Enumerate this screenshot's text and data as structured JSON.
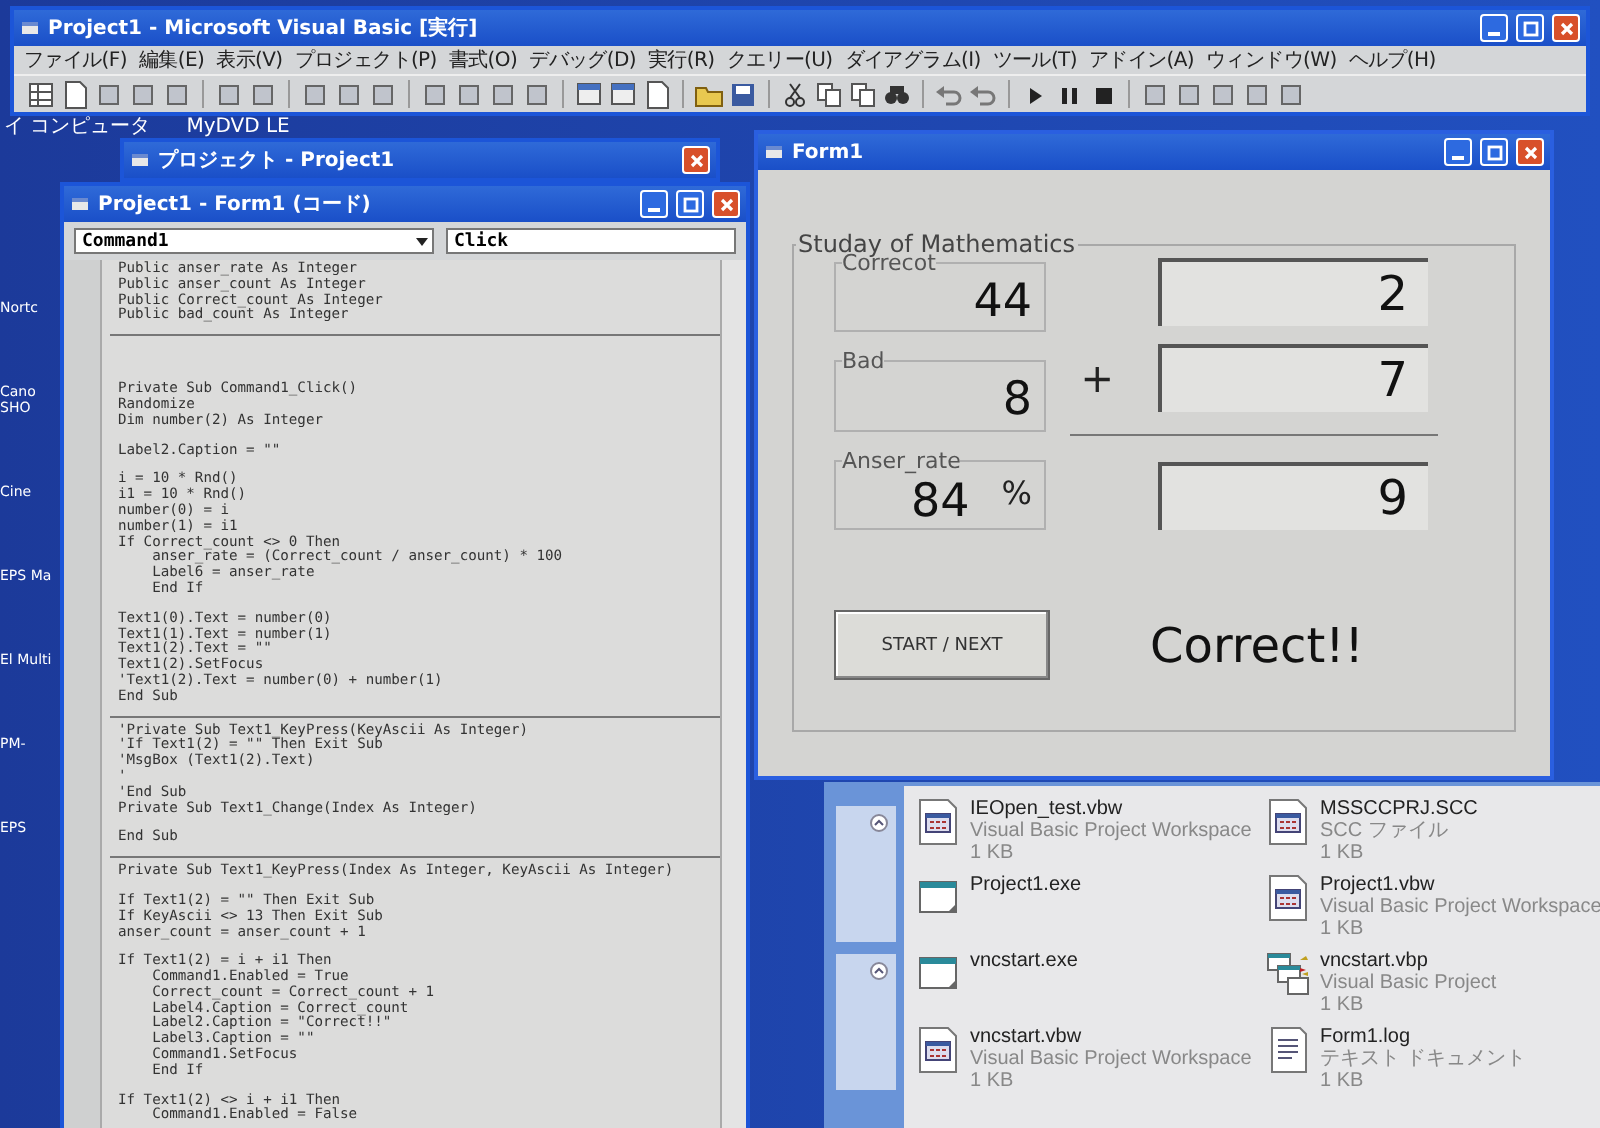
{
  "vb_window": {
    "title": "Project1 - Microsoft Visual Basic [実行]",
    "menu": [
      "ファイル(F)",
      "編集(E)",
      "表示(V)",
      "プロジェクト(P)",
      "書式(O)",
      "デバッグ(D)",
      "実行(R)",
      "クエリー(U)",
      "ダイアグラム(I)",
      "ツール(T)",
      "アドイン(A)",
      "ウィンドウ(W)",
      "ヘルプ(H)"
    ]
  },
  "desktop_top_icons": [
    "イ コンピュータ",
    "MyDVD LE"
  ],
  "desktop_side_icons": [
    "Nortc",
    "Cano SHO",
    "Cine",
    "EPS Ma",
    "El Multi",
    "PM-",
    "EPS"
  ],
  "project_window": {
    "title": "プロジェクト - Project1"
  },
  "code_window": {
    "title": "Project1 - Form1 (コード)",
    "object": "Command1",
    "procedure": "Click",
    "sections": [
      {
        "blocks": [
          [
            "Public anser_rate As Integer",
            "Public anser_count As Integer",
            "Public Correct_count As Integer",
            "Public bad_count As Integer"
          ]
        ]
      },
      {
        "blocks": [
          [
            "Private Sub Command1_Click()",
            "Randomize",
            "Dim number(2) As Integer"
          ],
          [
            "Label2.Caption = \"\""
          ],
          [
            "i = 10 * Rnd()",
            "i1 = 10 * Rnd()",
            "number(0) = i",
            "number(1) = i1",
            "If Correct_count <> 0 Then",
            "    anser_rate = (Correct_count / anser_count) * 100",
            "    Label6 = anser_rate",
            "    End If"
          ],
          [
            "Text1(0).Text = number(0)",
            "Text1(1).Text = number(1)",
            "Text1(2).Text = \"\"",
            "Text1(2).SetFocus",
            "'Text1(2).Text = number(0) + number(1)",
            "End Sub"
          ]
        ]
      },
      {
        "blocks": [
          [
            "'Private Sub Text1_KeyPress(KeyAscii As Integer)",
            "'If Text1(2) = \"\" Then Exit Sub",
            "'MsgBox (Text1(2).Text)",
            "'",
            "'End Sub",
            "Private Sub Text1_Change(Index As Integer)"
          ],
          [
            "End Sub"
          ]
        ]
      },
      {
        "blocks": [
          [
            "Private Sub Text1_KeyPress(Index As Integer, KeyAscii As Integer)"
          ],
          [
            "If Text1(2) = \"\" Then Exit Sub",
            "If KeyAscii <> 13 Then Exit Sub",
            "anser_count = anser_count + 1"
          ],
          [
            "If Text1(2) = i + i1 Then",
            "    Command1.Enabled = True",
            "    Correct_count = Correct_count + 1",
            "    Label4.Caption = Correct_count",
            "    Label2.Caption = \"Correct!!\"",
            "    Label3.Caption = \"\"",
            "    Command1.SetFocus",
            "    End If"
          ],
          [
            "If Text1(2) <> i + i1 Then",
            "    Command1.Enabled = False"
          ]
        ]
      }
    ]
  },
  "form_window": {
    "title": "Form1",
    "frame": "Studay of Mathematics",
    "stats": [
      {
        "label": "Correcot",
        "value": "44"
      },
      {
        "label": "Bad",
        "value": "8"
      },
      {
        "label": "Anser_rate",
        "value": "84",
        "unit": "%"
      }
    ],
    "operands": [
      "2",
      "7"
    ],
    "operator": "+",
    "answer": "9",
    "button": "START / NEXT",
    "result": "Correct!!"
  },
  "explorer": {
    "files": [
      {
        "name": "IEOpen_test.vbw",
        "type": "Visual Basic Project Workspace",
        "size": "1 KB",
        "kind": "workspace"
      },
      {
        "name": "MSSCCPRJ.SCC",
        "type": "SCC ファイル",
        "size": "1 KB",
        "kind": "workspace"
      },
      {
        "name": "Project1.exe",
        "kind": "exe"
      },
      {
        "name": "Project1.vbw",
        "type": "Visual Basic Project Workspace",
        "size": "1 KB",
        "kind": "workspace"
      },
      {
        "name": "vncstart.exe",
        "kind": "exe"
      },
      {
        "name": "vncstart.vbp",
        "type": "Visual Basic Project",
        "size": "1 KB",
        "kind": "project"
      },
      {
        "name": "vncstart.vbw",
        "type": "Visual Basic Project Workspace",
        "size": "1 KB",
        "kind": "workspace"
      },
      {
        "name": "Form1.log",
        "type": "テキスト ドキュメント",
        "size": "1 KB",
        "kind": "text"
      }
    ]
  }
}
